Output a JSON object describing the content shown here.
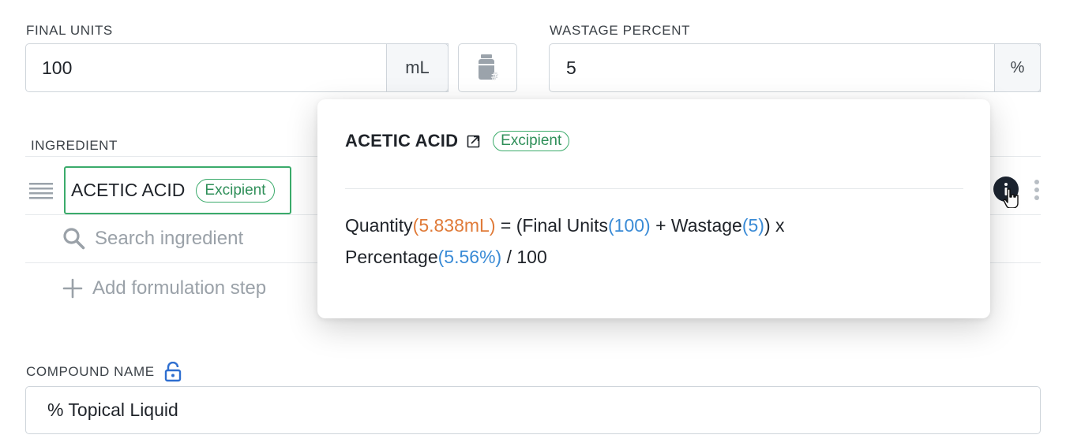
{
  "final_units": {
    "label": "FINAL UNITS",
    "value": "100",
    "unit": "mL"
  },
  "wastage_percent": {
    "label": "WASTAGE PERCENT",
    "value": "5",
    "unit": "%"
  },
  "ingredients": {
    "header": "INGREDIENT",
    "rows": [
      {
        "name": "ACETIC ACID",
        "badge": "Excipient"
      }
    ],
    "search_placeholder": "Search ingredient",
    "add_step_label": "Add formulation step"
  },
  "popover": {
    "title": "ACETIC ACID",
    "badge": "Excipient",
    "formula": {
      "q_label": "Quantity",
      "q_value": "(5.838mL)",
      "eq": " = (Final Units",
      "fu_value": "(100)",
      "plus": " + Wastage",
      "w_value": "(5)",
      "x": ") x",
      "p_label": "Percentage",
      "p_value": "(5.56%)",
      "div": " / 100"
    }
  },
  "compound_name": {
    "label": "COMPOUND NAME",
    "value": "% Topical Liquid"
  },
  "icons": [
    "bottle-hash-icon",
    "drag-handle-icon",
    "search-icon",
    "plus-icon",
    "external-link-icon",
    "info-icon",
    "kebab-menu-icon",
    "lock-open-icon"
  ],
  "colors": {
    "accent_green": "#3bab6b",
    "formula_orange": "#e07b39",
    "formula_blue": "#3a8bd6"
  }
}
